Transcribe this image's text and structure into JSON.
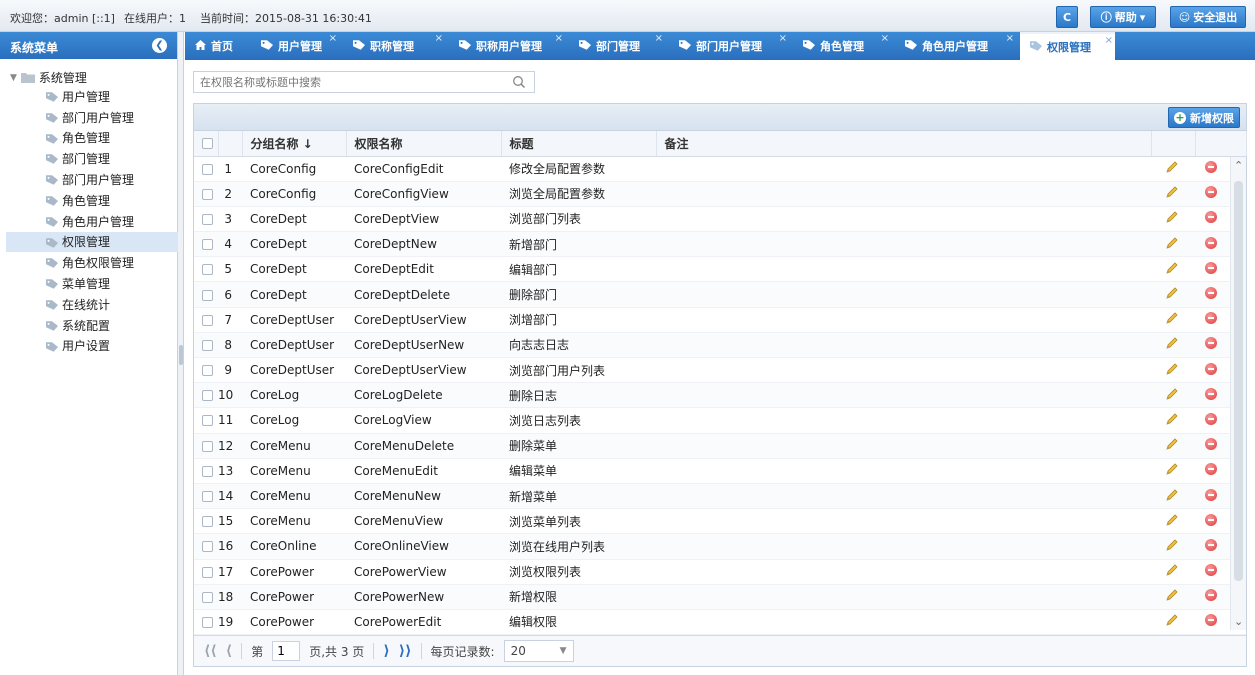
{
  "topbar": {
    "welcome": "欢迎您：admin [::1]",
    "online": "在线用户：1",
    "time": "当前时间：2015-08-31 16:30:41",
    "refresh_label": "C",
    "help_label": "帮助",
    "logout_label": "安全退出"
  },
  "sidebar": {
    "title": "系统菜单",
    "root": "系统管理",
    "items": [
      {
        "label": "用户管理"
      },
      {
        "label": "部门用户管理"
      },
      {
        "label": "角色管理"
      },
      {
        "label": "部门管理"
      },
      {
        "label": "部门用户管理"
      },
      {
        "label": "角色管理"
      },
      {
        "label": "角色用户管理"
      },
      {
        "label": "权限管理",
        "active": true
      },
      {
        "label": "角色权限管理"
      },
      {
        "label": "菜单管理"
      },
      {
        "label": "在线统计"
      },
      {
        "label": "系统配置"
      },
      {
        "label": "用户设置"
      }
    ]
  },
  "tabs": [
    {
      "label": "首页",
      "icon": "home-icon"
    },
    {
      "label": "用户管理",
      "icon": "tag-icon",
      "closable": true
    },
    {
      "label": "职称管理",
      "icon": "tag-icon",
      "closable": true
    },
    {
      "label": "职称用户管理",
      "icon": "tag-icon",
      "closable": true
    },
    {
      "label": "部门管理",
      "icon": "tag-icon",
      "closable": true
    },
    {
      "label": "部门用户管理",
      "icon": "tag-icon",
      "closable": true
    },
    {
      "label": "角色管理",
      "icon": "tag-icon",
      "closable": true
    },
    {
      "label": "角色用户管理",
      "icon": "tag-icon",
      "closable": true
    },
    {
      "label": "权限管理",
      "icon": "tag-icon",
      "closable": true,
      "active": true
    }
  ],
  "search": {
    "placeholder": "在权限名称或标题中搜索"
  },
  "toolbar": {
    "add_label": "新增权限"
  },
  "grid": {
    "columns": [
      "分组名称 ↓",
      "权限名称",
      "标题",
      "备注"
    ],
    "rows": [
      {
        "n": "1",
        "group": "CoreConfig",
        "name": "CoreConfigEdit",
        "title": "修改全局配置参数"
      },
      {
        "n": "2",
        "group": "CoreConfig",
        "name": "CoreConfigView",
        "title": "浏览全局配置参数"
      },
      {
        "n": "3",
        "group": "CoreDept",
        "name": "CoreDeptView",
        "title": "浏览部门列表"
      },
      {
        "n": "4",
        "group": "CoreDept",
        "name": "CoreDeptNew",
        "title": "新增部门"
      },
      {
        "n": "5",
        "group": "CoreDept",
        "name": "CoreDeptEdit",
        "title": "编辑部门"
      },
      {
        "n": "6",
        "group": "CoreDept",
        "name": "CoreDeptDelete",
        "title": "删除部门"
      },
      {
        "n": "7",
        "group": "CoreDeptUser",
        "name": "CoreDeptUserView",
        "title": "浏增部门"
      },
      {
        "n": "8",
        "group": "CoreDeptUser",
        "name": "CoreDeptUserNew",
        "title": "向志志日志"
      },
      {
        "n": "9",
        "group": "CoreDeptUser",
        "name": "CoreDeptUserView",
        "title": "浏览部门用户列表"
      },
      {
        "n": "10",
        "group": "CoreLog",
        "name": "CoreLogDelete",
        "title": "删除日志"
      },
      {
        "n": "11",
        "group": "CoreLog",
        "name": "CoreLogView",
        "title": "浏览日志列表"
      },
      {
        "n": "12",
        "group": "CoreMenu",
        "name": "CoreMenuDelete",
        "title": "删除菜单"
      },
      {
        "n": "13",
        "group": "CoreMenu",
        "name": "CoreMenuEdit",
        "title": "编辑菜单"
      },
      {
        "n": "14",
        "group": "CoreMenu",
        "name": "CoreMenuNew",
        "title": "新增菜单"
      },
      {
        "n": "15",
        "group": "CoreMenu",
        "name": "CoreMenuView",
        "title": "浏览菜单列表"
      },
      {
        "n": "16",
        "group": "CoreOnline",
        "name": "CoreOnlineView",
        "title": "浏览在线用户列表"
      },
      {
        "n": "17",
        "group": "CorePower",
        "name": "CorePowerView",
        "title": "浏览权限列表"
      },
      {
        "n": "18",
        "group": "CorePower",
        "name": "CorePowerNew",
        "title": "新增权限"
      },
      {
        "n": "19",
        "group": "CorePower",
        "name": "CorePowerEdit",
        "title": "编辑权限"
      }
    ]
  },
  "pager": {
    "page_prefix": "第",
    "page": "1",
    "page_suffix": "页,共 3 页",
    "per_page_label": "每页记录数:",
    "per_page": "20"
  },
  "colors": {
    "accent": "#2a6fbd",
    "active_row": "#d9e6f5",
    "delete": "#d83a3a",
    "edit": "#e0b030"
  }
}
